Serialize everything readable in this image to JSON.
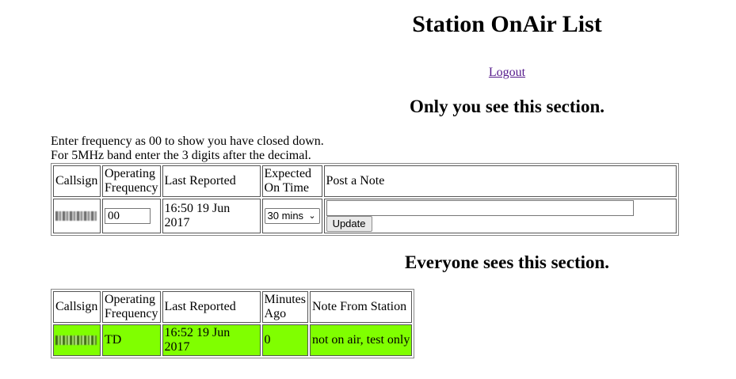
{
  "page_title": "Station OnAir List",
  "logout_label": "Logout",
  "private_section": {
    "heading": "Only you see this section.",
    "instructions": [
      "Enter frequency as 00 to show you have closed down.",
      "For 5MHz band enter the 3 digits after the decimal."
    ],
    "headers": [
      "Callsign",
      "Operating Frequency",
      "Last Reported",
      "Expected On Time",
      "Post a Note"
    ],
    "row": {
      "frequency_value": "00",
      "last_reported": "16:50 19 Jun 2017",
      "expected_on_time": "30 mins",
      "note_value": "",
      "update_label": "Update"
    }
  },
  "public_section": {
    "heading": "Everyone sees this section.",
    "headers": [
      "Callsign",
      "Operating Frequency",
      "Last Reported",
      "Minutes Ago",
      "Note From Station"
    ],
    "rows": [
      {
        "frequency": "TD",
        "last_reported": "16:52 19 Jun 2017",
        "minutes_ago": "0",
        "note": "not on air, test only",
        "row_color": "#80ff00"
      }
    ]
  }
}
